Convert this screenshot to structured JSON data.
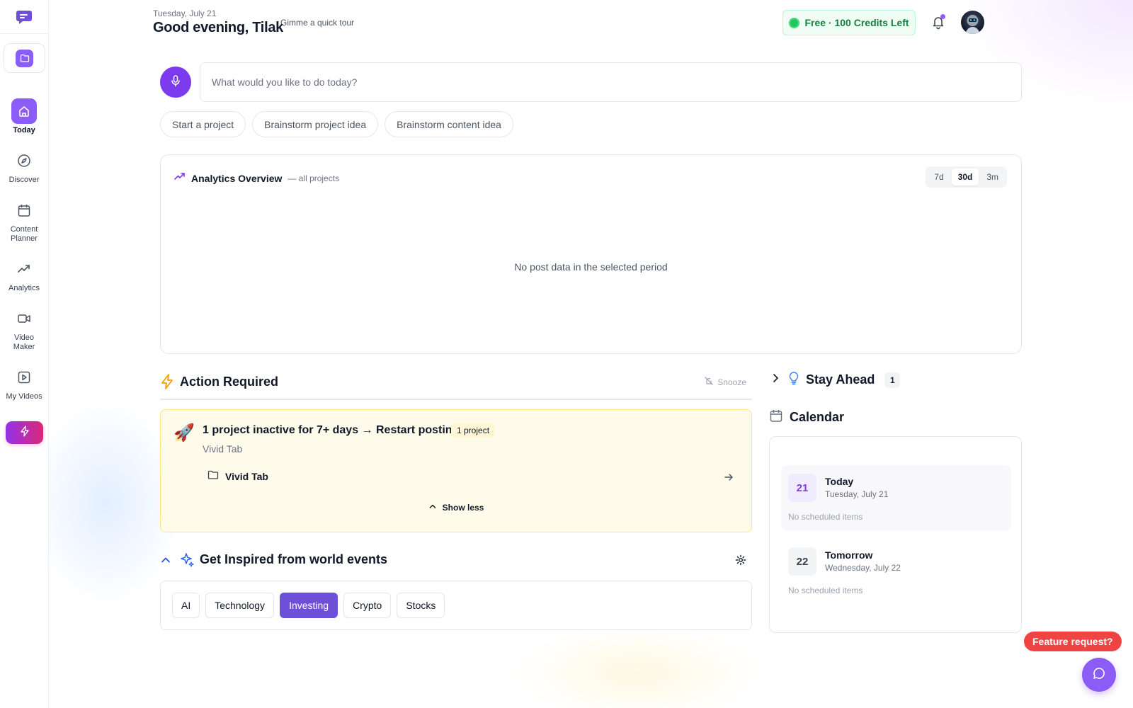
{
  "header": {
    "date": "Tuesday, July 21",
    "greeting": "Good evening, Tilak",
    "tour_link": "Gimme a quick tour",
    "credits": "Free · 100 Credits Left"
  },
  "sidebar": {
    "items": [
      {
        "label": "Today",
        "icon": "home-icon",
        "active": true
      },
      {
        "label": "Discover",
        "icon": "compass-icon"
      },
      {
        "label": "Content\nPlanner",
        "icon": "calendar-icon"
      },
      {
        "label": "Analytics",
        "icon": "trending-up-icon"
      },
      {
        "label": "Video\nMaker",
        "icon": "video-icon"
      },
      {
        "label": "My Videos",
        "icon": "play-square-icon"
      }
    ]
  },
  "prompt": {
    "placeholder": "What would you like to do today?",
    "suggestions": [
      "Start a project",
      "Brainstorm project idea",
      "Brainstorm content idea"
    ]
  },
  "analytics": {
    "title": "Analytics Overview",
    "subtitle": "— all projects",
    "ranges": [
      "7d",
      "30d",
      "3m"
    ],
    "selected_range": "30d",
    "empty_text": "No post data in the selected period"
  },
  "action_required": {
    "title": "Action Required",
    "snooze": "Snooze",
    "card_title": "1 project inactive for 7+ days → Restart posting",
    "badge": "1 project",
    "card_sub": "Vivid Tab",
    "project_name": "Vivid Tab",
    "toggle": "Show less"
  },
  "inspired": {
    "title": "Get Inspired from world events",
    "tags": [
      "AI",
      "Technology",
      "Investing",
      "Crypto",
      "Stocks"
    ],
    "selected_tag": "Investing"
  },
  "stay_ahead": {
    "title": "Stay Ahead",
    "count": "1"
  },
  "calendar": {
    "title": "Calendar",
    "days": [
      {
        "num": "21",
        "name": "Today",
        "date": "Tuesday, July 21",
        "status": "No scheduled items"
      },
      {
        "num": "22",
        "name": "Tomorrow",
        "date": "Wednesday, July 22",
        "status": "No scheduled items"
      }
    ]
  },
  "feature_request": "Feature request?",
  "colors": {
    "accent": "#8b5cf6",
    "selected_tag": "#6d4fd8",
    "credits_green": "#15803d",
    "warning_bg": "#fffbeb",
    "feature_red": "#ef4444"
  }
}
